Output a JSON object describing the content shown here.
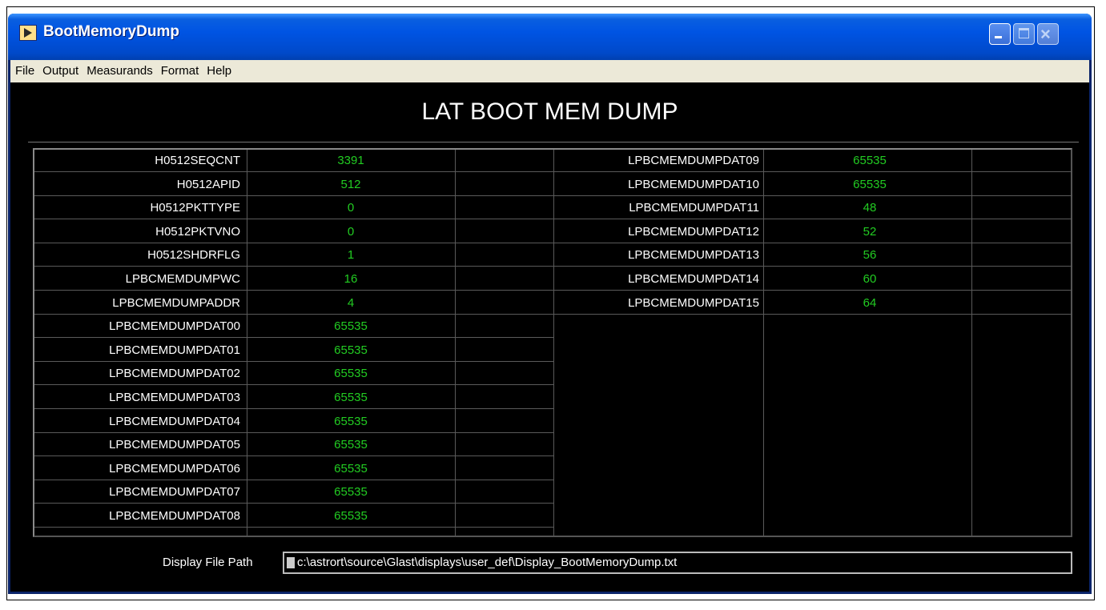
{
  "window": {
    "title": "BootMemoryDump"
  },
  "menu": [
    "File",
    "Output",
    "Measurands",
    "Format",
    "Help"
  ],
  "heading": "LAT BOOT MEM DUMP",
  "left_rows": [
    {
      "label": "H0512SEQCNT",
      "value": "3391"
    },
    {
      "label": "H0512APID",
      "value": "512"
    },
    {
      "label": "H0512PKTTYPE",
      "value": "0"
    },
    {
      "label": "H0512PKTVNO",
      "value": "0"
    },
    {
      "label": "H0512SHDRFLG",
      "value": "1"
    },
    {
      "label": "LPBCMEMDUMPWC",
      "value": "16"
    },
    {
      "label": "LPBCMEMDUMPADDR",
      "value": "4"
    },
    {
      "label": "LPBCMEMDUMPDAT00",
      "value": "65535"
    },
    {
      "label": "LPBCMEMDUMPDAT01",
      "value": "65535"
    },
    {
      "label": "LPBCMEMDUMPDAT02",
      "value": "65535"
    },
    {
      "label": "LPBCMEMDUMPDAT03",
      "value": "65535"
    },
    {
      "label": "LPBCMEMDUMPDAT04",
      "value": "65535"
    },
    {
      "label": "LPBCMEMDUMPDAT05",
      "value": "65535"
    },
    {
      "label": "LPBCMEMDUMPDAT06",
      "value": "65535"
    },
    {
      "label": "LPBCMEMDUMPDAT07",
      "value": "65535"
    },
    {
      "label": "LPBCMEMDUMPDAT08",
      "value": "65535"
    }
  ],
  "right_rows": [
    {
      "label": "LPBCMEMDUMPDAT09",
      "value": "65535"
    },
    {
      "label": "LPBCMEMDUMPDAT10",
      "value": "65535"
    },
    {
      "label": "LPBCMEMDUMPDAT11",
      "value": "48"
    },
    {
      "label": "LPBCMEMDUMPDAT12",
      "value": "52"
    },
    {
      "label": "LPBCMEMDUMPDAT13",
      "value": "56"
    },
    {
      "label": "LPBCMEMDUMPDAT14",
      "value": "60"
    },
    {
      "label": "LPBCMEMDUMPDAT15",
      "value": "64"
    }
  ],
  "display_path": {
    "label": "Display File Path",
    "value": "c:\\astrort\\source\\Glast\\displays\\user_def\\Display_BootMemoryDump.txt"
  },
  "colors": {
    "value_green": "#22cc22",
    "panel_bg": "#000000",
    "title_blue": "#0054e3"
  }
}
